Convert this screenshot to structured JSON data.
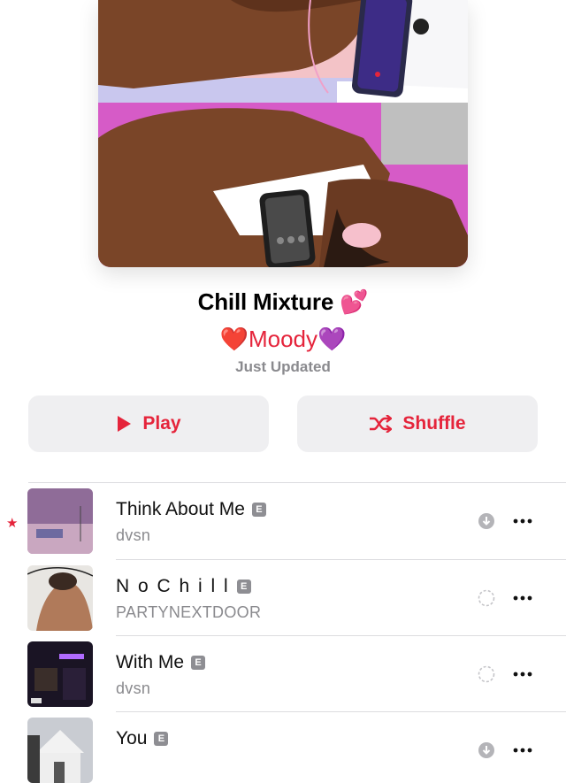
{
  "playlist": {
    "title": "Chill Mixture",
    "title_emoji": "💕",
    "curator_prefix_emoji": "❤️",
    "curator": "Moody",
    "curator_suffix_emoji": "💜",
    "updated": "Just Updated"
  },
  "actions": {
    "play_label": "Play",
    "shuffle_label": "Shuffle"
  },
  "colors": {
    "accent": "#e5243b",
    "button_bg": "#efeff1",
    "secondary_text": "#8a8a8e"
  },
  "explicit_badge": "E",
  "tracks": [
    {
      "title": "Think About Me",
      "artist": "dvsn",
      "explicit": true,
      "favorited": true,
      "status_icon": "downloaded-icon"
    },
    {
      "title": "N o  C h i l l",
      "artist": "PARTYNEXTDOOR",
      "explicit": true,
      "favorited": false,
      "status_icon": "download-progress-icon"
    },
    {
      "title": "With Me",
      "artist": "dvsn",
      "explicit": true,
      "favorited": false,
      "status_icon": "download-progress-icon"
    },
    {
      "title": "You",
      "artist": "",
      "explicit": true,
      "favorited": false,
      "status_icon": "downloaded-icon"
    }
  ],
  "favorite_mark": "★"
}
